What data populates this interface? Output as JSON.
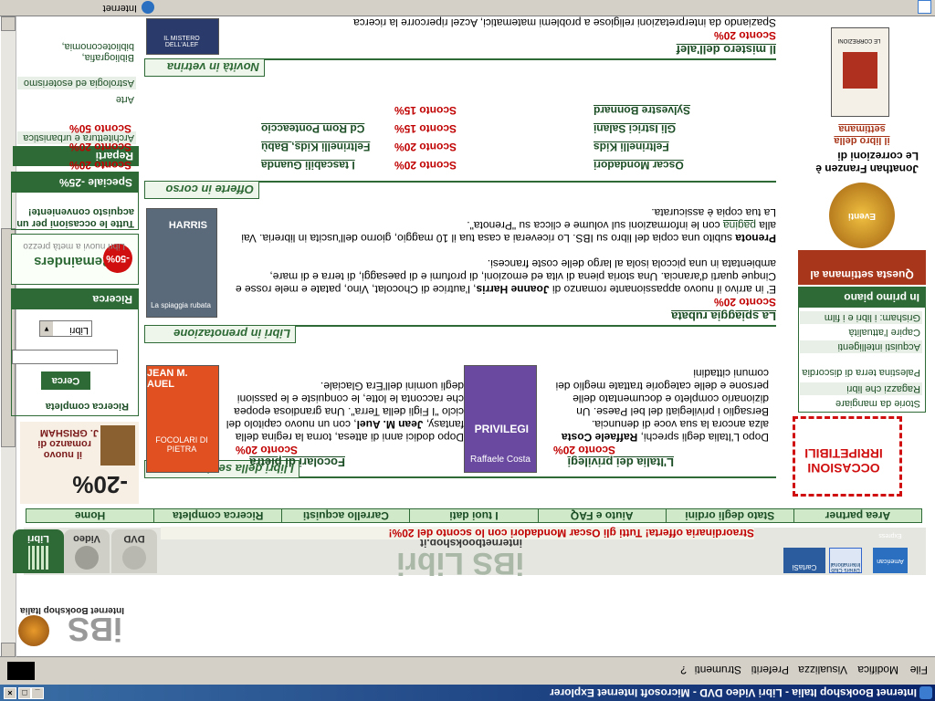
{
  "window": {
    "title": "Internet Bookshop Italia - Libri Video DVD - Microsoft Internet Explorer",
    "menu": [
      "File",
      "Modifica",
      "Visualizza",
      "Preferiti",
      "Strumenti",
      "?"
    ],
    "status_zone": "Internet"
  },
  "header": {
    "logo_tagline": "Internet Bookshop Italia",
    "logo_text": "iBS",
    "brand_title": "iBS Libri",
    "brand_url": "internetbookshop.it",
    "tabs": [
      "Libri",
      "Video",
      "DVD"
    ],
    "promo": "Straordinaria offerta! Tutti gli Oscar Mondadori con lo sconto del 20%!",
    "cards": [
      "CartaSi",
      "Diners Club International",
      "American Express"
    ]
  },
  "nav": [
    "Home",
    "Ricerca completa",
    "Carrello acquisti",
    "I tuoi dati",
    "Aiuto e FAQ",
    "Stato degli ordini",
    "Area partner"
  ],
  "left": {
    "grisham_promo": {
      "line1": "il nuovo",
      "line2": "romanzo di",
      "line3": "J. GRISHAM",
      "discount": "-20%"
    },
    "search": {
      "title": "Ricerca",
      "select": "Libri",
      "button": "Cerca",
      "link": "Ricerca completa"
    },
    "remainders": {
      "title": "Remainders",
      "badge": "-50%",
      "subtitle": "Libri nuovi a metà prezzo"
    },
    "speciale": {
      "title": "Speciale -25%",
      "link": "Tutte le occasioni per un acquisto conveniente!"
    },
    "reparti": {
      "title": "Reparti",
      "items": [
        "Architettura e urbanistica",
        "Arte",
        "Astrologia ed esoterismo",
        "Bibliografia, biblioteconomia,"
      ]
    }
  },
  "right": {
    "occasioni": "OCCASIONI IRRIPETIBILI",
    "primo_piano": {
      "title": "In primo piano",
      "items": [
        "Grisham: i libri e i film",
        "Capire l'attualità",
        "Acquisti intelligenti",
        "Palestina terra di discordia",
        "Ragazzi che libri",
        "Storie da mangiare"
      ]
    },
    "settimana": {
      "title": "Questa settimana al",
      "badge": "Eventi",
      "book_line1": "Le correzioni di",
      "book_line2": "Jonathan Franzen è",
      "book_line3": "il libro della settimana",
      "cover_text": "LE CORREZIONI"
    }
  },
  "main": {
    "libri_settimana": {
      "title": "I libri della settimana",
      "book1": {
        "title": "Focolari di pietra",
        "discount": "Sconto 20%",
        "text_intro": "Dopo dodici anni di attesa, torna la regina della fantasy, ",
        "author": "Jean M. Auel",
        "text_rest": ", con un nuovo capitolo del ciclo \"I Figli della Terra\". Una grandiosa epopea che racconta le lotte, le conquiste e le passioni degli uomini dell'Era Glaciale.",
        "cover_author": "JEAN M. AUEL",
        "cover_title": "FOCOLARI DI PIETRA"
      },
      "book2": {
        "title": "L'Italia dei privilegi",
        "discount": "Sconto 20%",
        "text_intro": "Dopo L'Italia degli sprechi, ",
        "author": "Raffaele Costa",
        "text_rest": " alza ancora la sua voce di denuncia. Bersaglio i privilegiati del bel Paese. Un dizionario completo e documentato delle persone e delle categorie trattate meglio dei comuni cittadini",
        "cover_author": "Raffaele Costa",
        "cover_title": "PRIVILEGI"
      }
    },
    "prenotazione": {
      "title": "Libri in prenotazione",
      "book_title": "La spiaggia rubata",
      "discount": "Sconto 20%",
      "p1_a": "E' in arrivo il nuovo appassionante romanzo di ",
      "p1_author": "Joanne Harris",
      "p1_b": ", l'autrice di Chocolat, Vino, patate e mele rosse e Cinque quarti d'arancia. Una storia piena di vita ed emozioni, di profumi e di paesaggi, di terra e di mare, ambientata in una piccola isola al largo delle coste francesi.",
      "p2_a": "Prenota",
      "p2_b": " subito una copia del libro su IBS. Lo riceverai a casa tua il 10 maggio, giorno dell'uscita in libreria. Vai alla ",
      "p2_link": "pagina",
      "p2_c": " con le informazioni sul volume e clicca su \"Prenota\".",
      "p3": "La tua copia è assicurata.",
      "cover_author": "HARRIS",
      "cover_title": "La spiaggia rubata"
    },
    "offerte": {
      "title": "Offerte in corso",
      "rows": [
        {
          "name": "Oscar Mondadori",
          "discount": "Sconto 20%",
          "name2": "I tascabili Guanda",
          "discount2": "Sconto 20%"
        },
        {
          "name": "Feltrinelli Kids",
          "discount": "Sconto 20%",
          "name2": "Feltrinelli Kids, Babù",
          "discount2": "Sconto 20%"
        },
        {
          "name": "Gli Istrici Salani",
          "discount": "Sconto 15%",
          "name2": "Cd Rom Ponteaccio",
          "discount2": "Sconto 50%"
        },
        {
          "name": "Sylvestre Bonnard",
          "discount": "Sconto 15%",
          "name2": "",
          "discount2": ""
        }
      ]
    },
    "vetrina": {
      "title": "Novità in vetrina",
      "book_title": "Il mistero dell'alef",
      "discount": "Sconto 20%",
      "text": "Spaziando da interpretazioni religiose a problemi matematici, Aczel ripercorre la ricerca",
      "cover_text": "IL MISTERO DELL'ALEF"
    }
  }
}
